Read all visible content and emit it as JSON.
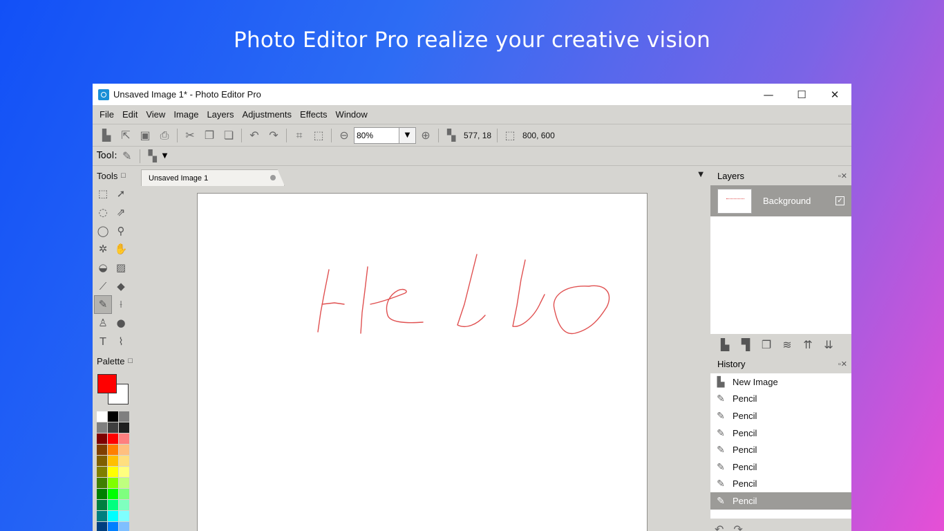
{
  "headline": "Photo Editor Pro realize your creative vision",
  "window": {
    "title": "Unsaved Image 1* - Photo Editor Pro",
    "controls": {
      "minimize": "—",
      "maximize": "☐",
      "close": "✕"
    }
  },
  "menu": [
    "File",
    "Edit",
    "View",
    "Image",
    "Layers",
    "Adjustments",
    "Effects",
    "Window"
  ],
  "toolbar": {
    "zoom_value": "80%",
    "cursor_position": "577, 18",
    "image_size": "800, 600"
  },
  "tool_options": {
    "label": "Tool:"
  },
  "tools_panel": {
    "title": "Tools"
  },
  "palette_panel": {
    "title": "Palette",
    "foreground_color": "#ff0000",
    "background_color": "#ffffff",
    "colors": [
      "#ffffff",
      "#000000",
      "#7f7f7f",
      "#7f7f7f",
      "#3f3f3f",
      "#1f1f1f",
      "#7f0000",
      "#ff0000",
      "#ff7f7f",
      "#7f3f00",
      "#ff7f00",
      "#ffbf7f",
      "#7f5f00",
      "#ffbf00",
      "#ffdf7f",
      "#7f7f00",
      "#ffff00",
      "#ffff7f",
      "#3f7f00",
      "#7fff00",
      "#bfff7f",
      "#007f00",
      "#00ff00",
      "#7fff7f",
      "#007f3f",
      "#00ff7f",
      "#7fffbf",
      "#007f7f",
      "#00ffff",
      "#7fffff",
      "#003f7f",
      "#007fff",
      "#7fbfff"
    ]
  },
  "document": {
    "tab_label": "Unsaved Image 1",
    "drawing_color": "#e05050"
  },
  "layers_panel": {
    "title": "Layers",
    "layers": [
      {
        "name": "Background",
        "visible": true
      }
    ]
  },
  "history_panel": {
    "title": "History",
    "items": [
      {
        "label": "New Image",
        "icon": "new-image-icon"
      },
      {
        "label": "Pencil",
        "icon": "pencil-icon"
      },
      {
        "label": "Pencil",
        "icon": "pencil-icon"
      },
      {
        "label": "Pencil",
        "icon": "pencil-icon"
      },
      {
        "label": "Pencil",
        "icon": "pencil-icon"
      },
      {
        "label": "Pencil",
        "icon": "pencil-icon"
      },
      {
        "label": "Pencil",
        "icon": "pencil-icon"
      },
      {
        "label": "Pencil",
        "icon": "pencil-icon",
        "selected": true
      }
    ]
  }
}
